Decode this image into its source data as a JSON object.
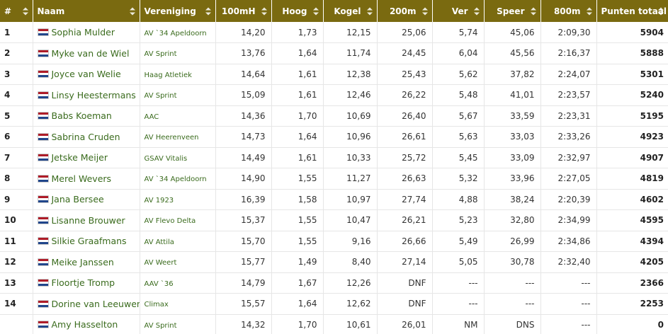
{
  "columns": [
    {
      "label": "#",
      "align": "left"
    },
    {
      "label": "Naam",
      "align": "left"
    },
    {
      "label": "Vereniging",
      "align": "left"
    },
    {
      "label": "100mH",
      "align": "right"
    },
    {
      "label": "Hoog",
      "align": "right"
    },
    {
      "label": "Kogel",
      "align": "right"
    },
    {
      "label": "200m",
      "align": "right"
    },
    {
      "label": "Ver",
      "align": "right"
    },
    {
      "label": "Speer",
      "align": "right"
    },
    {
      "label": "800m",
      "align": "right"
    },
    {
      "label": "Punten totaal",
      "align": "right"
    }
  ],
  "flag_icon": "netherlands-flag-icon",
  "colors": {
    "header_bg": "#7a6a10",
    "link": "#3a6b1d",
    "flag_red": "#ae1c28",
    "flag_blue": "#21468b"
  },
  "rows": [
    {
      "rank": "1",
      "name": "Sophia Mulder",
      "club": "AV `34 Apeldoorn",
      "h100": "14,20",
      "hoog": "1,73",
      "kogel": "12,15",
      "m200": "25,06",
      "ver": "5,74",
      "speer": "45,06",
      "m800": "2:09,30",
      "total": "5904"
    },
    {
      "rank": "2",
      "name": "Myke van de Wiel",
      "club": "AV Sprint",
      "h100": "13,76",
      "hoog": "1,64",
      "kogel": "11,74",
      "m200": "24,45",
      "ver": "6,04",
      "speer": "45,56",
      "m800": "2:16,37",
      "total": "5888"
    },
    {
      "rank": "3",
      "name": "Joyce van Welie",
      "club": "Haag Atletiek",
      "h100": "14,64",
      "hoog": "1,61",
      "kogel": "12,38",
      "m200": "25,43",
      "ver": "5,62",
      "speer": "37,82",
      "m800": "2:24,07",
      "total": "5301"
    },
    {
      "rank": "4",
      "name": "Linsy Heestermans",
      "club": "AV Sprint",
      "h100": "15,09",
      "hoog": "1,61",
      "kogel": "12,46",
      "m200": "26,22",
      "ver": "5,48",
      "speer": "41,01",
      "m800": "2:23,57",
      "total": "5240"
    },
    {
      "rank": "5",
      "name": "Babs Koeman",
      "club": "AAC",
      "h100": "14,36",
      "hoog": "1,70",
      "kogel": "10,69",
      "m200": "26,40",
      "ver": "5,67",
      "speer": "33,59",
      "m800": "2:23,31",
      "total": "5195"
    },
    {
      "rank": "6",
      "name": "Sabrina Cruden",
      "club": "AV Heerenveen",
      "h100": "14,73",
      "hoog": "1,64",
      "kogel": "10,96",
      "m200": "26,61",
      "ver": "5,63",
      "speer": "33,03",
      "m800": "2:33,26",
      "total": "4923"
    },
    {
      "rank": "7",
      "name": "Jetske Meijer",
      "club": "GSAV Vitalis",
      "h100": "14,49",
      "hoog": "1,61",
      "kogel": "10,33",
      "m200": "25,72",
      "ver": "5,45",
      "speer": "33,09",
      "m800": "2:32,97",
      "total": "4907"
    },
    {
      "rank": "8",
      "name": "Merel Wevers",
      "club": "AV `34 Apeldoorn",
      "h100": "14,90",
      "hoog": "1,55",
      "kogel": "11,27",
      "m200": "26,63",
      "ver": "5,32",
      "speer": "33,96",
      "m800": "2:27,05",
      "total": "4819"
    },
    {
      "rank": "9",
      "name": "Jana Bersee",
      "club": "AV 1923",
      "h100": "16,39",
      "hoog": "1,58",
      "kogel": "10,97",
      "m200": "27,74",
      "ver": "4,88",
      "speer": "38,24",
      "m800": "2:20,39",
      "total": "4602"
    },
    {
      "rank": "10",
      "name": "Lisanne Brouwer",
      "club": "AV Flevo Delta",
      "h100": "15,37",
      "hoog": "1,55",
      "kogel": "10,47",
      "m200": "26,21",
      "ver": "5,23",
      "speer": "32,80",
      "m800": "2:34,99",
      "total": "4595"
    },
    {
      "rank": "11",
      "name": "Silkie Graafmans",
      "club": "AV Attila",
      "h100": "15,70",
      "hoog": "1,55",
      "kogel": "9,16",
      "m200": "26,66",
      "ver": "5,49",
      "speer": "26,99",
      "m800": "2:34,86",
      "total": "4394"
    },
    {
      "rank": "12",
      "name": "Meike Janssen",
      "club": "AV Weert",
      "h100": "15,77",
      "hoog": "1,49",
      "kogel": "8,40",
      "m200": "27,14",
      "ver": "5,05",
      "speer": "30,78",
      "m800": "2:32,40",
      "total": "4205"
    },
    {
      "rank": "13",
      "name": "Floortje Tromp",
      "club": "AAV `36",
      "h100": "14,79",
      "hoog": "1,67",
      "kogel": "12,26",
      "m200": "DNF",
      "ver": "---",
      "speer": "---",
      "m800": "---",
      "total": "2366"
    },
    {
      "rank": "14",
      "name": "Dorine van Leeuwen",
      "club": "Climax",
      "h100": "15,57",
      "hoog": "1,64",
      "kogel": "12,62",
      "m200": "DNF",
      "ver": "---",
      "speer": "---",
      "m800": "---",
      "total": "2253"
    },
    {
      "rank": "",
      "name": "Amy Hasselton",
      "club": "AV Sprint",
      "h100": "14,32",
      "hoog": "1,70",
      "kogel": "10,61",
      "m200": "26,01",
      "ver": "NM",
      "speer": "DNS",
      "m800": "---",
      "total": "0"
    }
  ]
}
